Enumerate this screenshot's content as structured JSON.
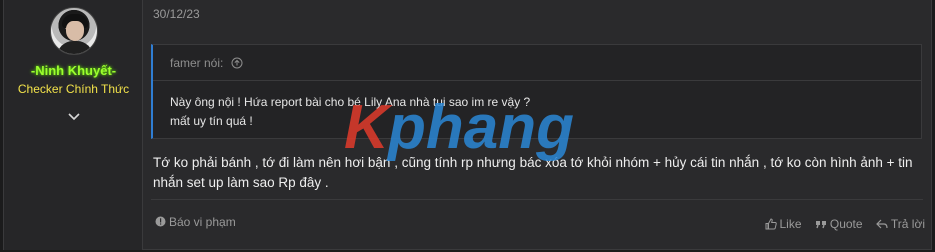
{
  "user": {
    "name": "-Ninh Khuyết-",
    "title": "Checker Chính Thức",
    "avatar_icon": "avatar-photo",
    "expand_icon": "chevron-down-icon"
  },
  "post": {
    "date": "30/12/23",
    "quote": {
      "author_line": "famer nói:",
      "line1": "Này ông nội ! Hứa report bài cho bé Lily Ana nhà tui sao im re vậy ?",
      "line2": "mất uy tín quá !"
    },
    "message": "Tớ ko phải bánh , tớ đi làm nên hơi bận , cũng tính rp nhưng bác xóa tớ khỏi nhóm + hủy cái tin nhắn , tớ ko còn hình ảnh + tin nhắn set up làm sao Rp đây ."
  },
  "watermark": {
    "text": "Kphang",
    "colors": [
      "#e23b2b",
      "#2b87d6"
    ]
  },
  "footer": {
    "report_label": "Báo vi phạm",
    "like_label": "Like",
    "quote_label": "Quote",
    "reply_label": "Trả lời"
  },
  "colors": {
    "username": "#9cff2e",
    "usertitle": "#f2e24a",
    "quote_border": "#2f7dd3",
    "background": "#2a2a2c"
  }
}
